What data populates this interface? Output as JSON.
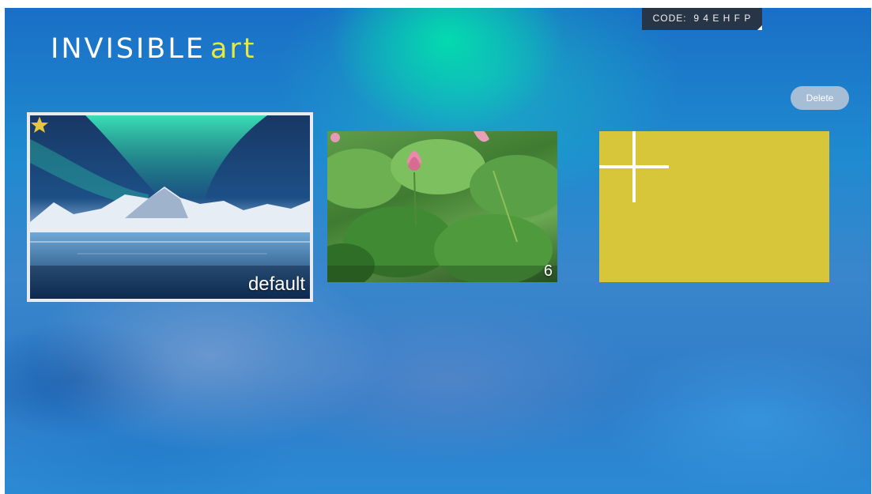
{
  "app": {
    "logo_primary": "INVISIBLE",
    "logo_accent": "art",
    "code_badge": "CODE:  9 4 E H F P",
    "delete_label": "Delete"
  },
  "gallery": {
    "items": [
      {
        "label": "default",
        "starred": true,
        "icon": "star-icon"
      },
      {
        "label": "6",
        "starred": false
      }
    ],
    "add_tile": {
      "icon": "plus-icon"
    }
  },
  "colors": {
    "accent_yellow": "#e9e93d",
    "add_tile": "#d7c63a",
    "star": "#e8c53a"
  }
}
